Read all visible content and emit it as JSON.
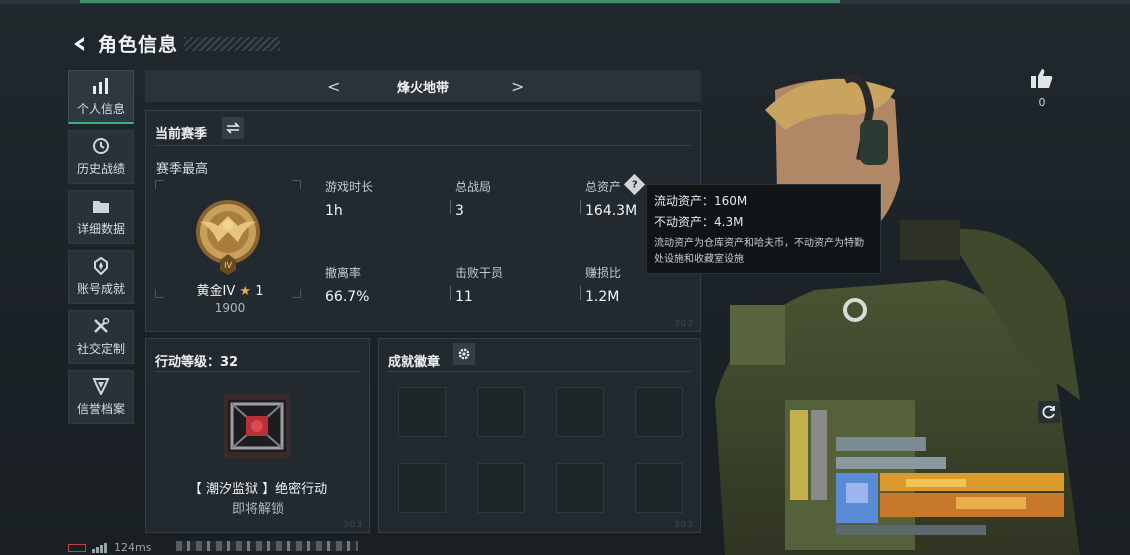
{
  "title": "角色信息",
  "sidebar": {
    "items": [
      {
        "label": "个人信息",
        "icon": "bar-chart-icon",
        "active": true
      },
      {
        "label": "历史战绩",
        "icon": "history-clock-icon",
        "active": false
      },
      {
        "label": "详细数据",
        "icon": "folder-icon",
        "active": false
      },
      {
        "label": "账号成就",
        "icon": "achievement-badge-icon",
        "active": false
      },
      {
        "label": "社交定制",
        "icon": "tools-icon",
        "active": false
      },
      {
        "label": "信誉档案",
        "icon": "credibility-shield-icon",
        "active": false
      }
    ]
  },
  "map_selector": {
    "name": "烽火地带",
    "prev": "<",
    "next": ">"
  },
  "season_panel": {
    "header": "当前赛季",
    "season_best": "赛季最高",
    "rank": {
      "name": "黄金IV",
      "stars": "1",
      "points": "1900",
      "medal_numeral": "IV"
    },
    "stats": [
      {
        "label": "游戏时长",
        "value": "1h"
      },
      {
        "label": "总战局",
        "value": "3"
      },
      {
        "label": "总资产",
        "value": "164.3M"
      },
      {
        "label": "撤离率",
        "value": "66.7%"
      },
      {
        "label": "击败干员",
        "value": "11"
      },
      {
        "label": "赚损比",
        "value": "1.2M"
      }
    ],
    "help_mark": "?",
    "corner_code": "303"
  },
  "tooltip": {
    "liquid": "流动资产：160M",
    "fixed": "不动资产：4.3M",
    "note": "流动资产为仓库资产和哈夫币，不动资产为特勤处设施和收藏室设施"
  },
  "operation_panel": {
    "header": "行动等级：32",
    "unlock_title": "【 潮汐监狱 】绝密行动",
    "unlock_status": "即将解锁",
    "corner_code": "303"
  },
  "badges_panel": {
    "header": "成就徽章",
    "slots": 8,
    "corner_code": "303"
  },
  "likes": {
    "count": "0",
    "icon": "thumbs-up-icon"
  },
  "status_bar": {
    "ping": "124ms"
  },
  "colors": {
    "accent_green": "#3fb07a",
    "panel_bg": "#222a2f",
    "gold": "#c9a05a",
    "battery_red": "#c0453f"
  }
}
